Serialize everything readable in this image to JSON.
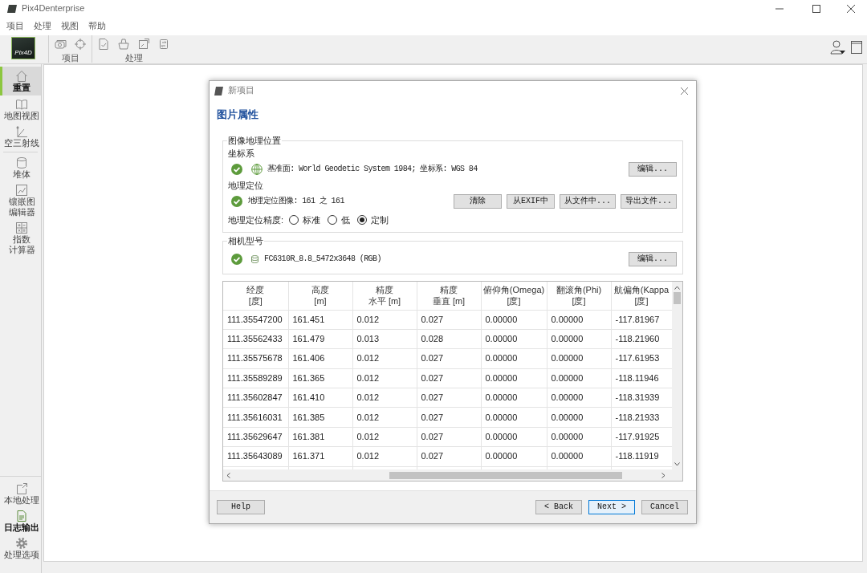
{
  "window": {
    "title": "Pix4Denterprise"
  },
  "menu": [
    {
      "label": "项目"
    },
    {
      "label": "处理"
    },
    {
      "label": "视图"
    },
    {
      "label": "帮助"
    }
  ],
  "toolbar": {
    "logo": "Pix4D",
    "groups": [
      {
        "label": "项目"
      },
      {
        "label": "处理"
      }
    ]
  },
  "sidebar": {
    "sections": [
      [
        {
          "label": "重置",
          "selected": true
        },
        {
          "label": "地图视图",
          "selected": false
        },
        {
          "label": "空三射线",
          "selected": false
        }
      ],
      [
        {
          "label": "堆体",
          "selected": false
        },
        {
          "label": "镶嵌图编辑器",
          "selected": false
        },
        {
          "label": "指数计算器",
          "selected": false
        }
      ]
    ],
    "bottom_items": [
      {
        "label": "本地处理",
        "on": false
      },
      {
        "label": "日志输出",
        "on": true
      },
      {
        "label": "处理选项",
        "on": false
      }
    ]
  },
  "dialog": {
    "title": "新项目",
    "heading": "图片属性",
    "geolocation_group": {
      "title": "图像地理位置",
      "coordinate_system": {
        "label": "坐标系",
        "ok": true,
        "text": "基准面: World Geodetic System 1984; 坐标系: WGS 84",
        "button": "编辑..."
      },
      "geolocation": {
        "label": "地理定位",
        "ok": true,
        "text": "地理定位图像: 161 之 161",
        "buttons": [
          "清除",
          "从EXIF中",
          "从文件中...",
          "导出文件..."
        ]
      },
      "accuracy": {
        "label": "地理定位精度:",
        "options": [
          {
            "label": "标准",
            "selected": false
          },
          {
            "label": "低",
            "selected": false
          },
          {
            "label": "定制",
            "selected": true
          }
        ]
      }
    },
    "camera_group": {
      "title": "相机型号",
      "ok": true,
      "text": "FC6310R_8.8_5472x3648 (RGB)",
      "button": "编辑..."
    },
    "table": {
      "columns": [
        {
          "title": "经度",
          "subtitle": "[度]"
        },
        {
          "title": "高度",
          "subtitle": "[m]"
        },
        {
          "title": "精度",
          "subtitle": "水平 [m]"
        },
        {
          "title": "精度",
          "subtitle": "垂直 [m]"
        },
        {
          "title": "俯仰角(Omega)",
          "subtitle": "[度]"
        },
        {
          "title": "翻滚角(Phi)",
          "subtitle": "[度]"
        },
        {
          "title": "航偏角(Kappa",
          "subtitle": "[度]"
        }
      ],
      "rows": [
        [
          "111.35547200",
          "161.451",
          "0.012",
          "0.027",
          "0.00000",
          "0.00000",
          "-117.81967"
        ],
        [
          "111.35562433",
          "161.479",
          "0.013",
          "0.028",
          "0.00000",
          "0.00000",
          "-118.21960"
        ],
        [
          "111.35575678",
          "161.406",
          "0.012",
          "0.027",
          "0.00000",
          "0.00000",
          "-117.61953"
        ],
        [
          "111.35589289",
          "161.365",
          "0.012",
          "0.027",
          "0.00000",
          "0.00000",
          "-118.11946"
        ],
        [
          "111.35602847",
          "161.410",
          "0.012",
          "0.027",
          "0.00000",
          "0.00000",
          "-118.31939"
        ],
        [
          "111.35616031",
          "161.385",
          "0.012",
          "0.027",
          "0.00000",
          "0.00000",
          "-118.21933"
        ],
        [
          "111.35629647",
          "161.381",
          "0.012",
          "0.027",
          "0.00000",
          "0.00000",
          "-117.91925"
        ],
        [
          "111.35643089",
          "161.371",
          "0.012",
          "0.027",
          "0.00000",
          "0.00000",
          "-118.11919"
        ]
      ]
    },
    "footer": {
      "left": [
        {
          "label": "Help",
          "default": false
        }
      ],
      "right": [
        {
          "label": "< Back",
          "default": false
        },
        {
          "label": "Next >",
          "default": true
        },
        {
          "label": "Cancel",
          "default": false
        }
      ]
    }
  }
}
